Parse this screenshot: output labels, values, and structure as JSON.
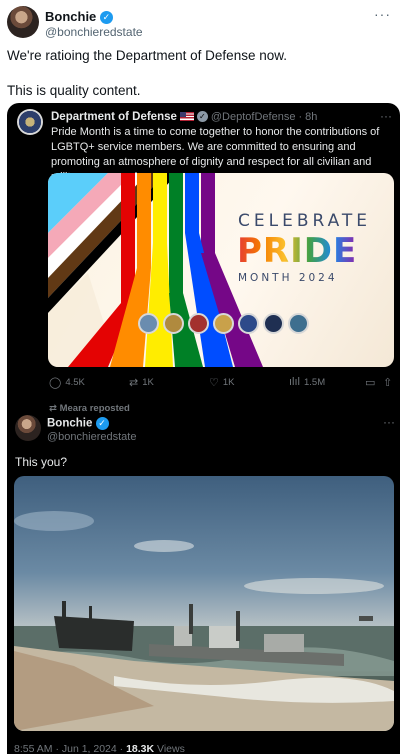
{
  "outer": {
    "name": "Bonchie",
    "handle": "@bonchieredstate",
    "more": "···",
    "line1": "We're ratioing the Department of Defense now.",
    "line2": "This is quality content."
  },
  "quoted": {
    "name": "Department of Defense",
    "handle": "@DeptofDefense",
    "time": "· 8h",
    "more": "···",
    "text": "Pride Month is a time to come together to honor the contributions of LGBTQ+ service members. We are committed to ensuring and promoting an atmosphere of dignity and respect for all civilian and military personnel.",
    "image": {
      "celebrate": "CELEBRATE",
      "pride": "PRIDE",
      "month": "MONTH 2024"
    },
    "actions": {
      "replies": "4.5K",
      "reposts": "1K",
      "likes": "1K",
      "views": "1.5M"
    }
  },
  "repost": {
    "label": "Meara reposted"
  },
  "reply": {
    "name": "Bonchie",
    "handle": "@bonchieredstate",
    "more": "···",
    "text": "This you?",
    "time": "8:55 AM · Jun 1, 2024 ·",
    "views": "18.3K",
    "views_label": "Views"
  },
  "colors": {
    "verified_blue": "#1d9bf0",
    "dark_bg": "#000000",
    "muted": "#71767b"
  }
}
